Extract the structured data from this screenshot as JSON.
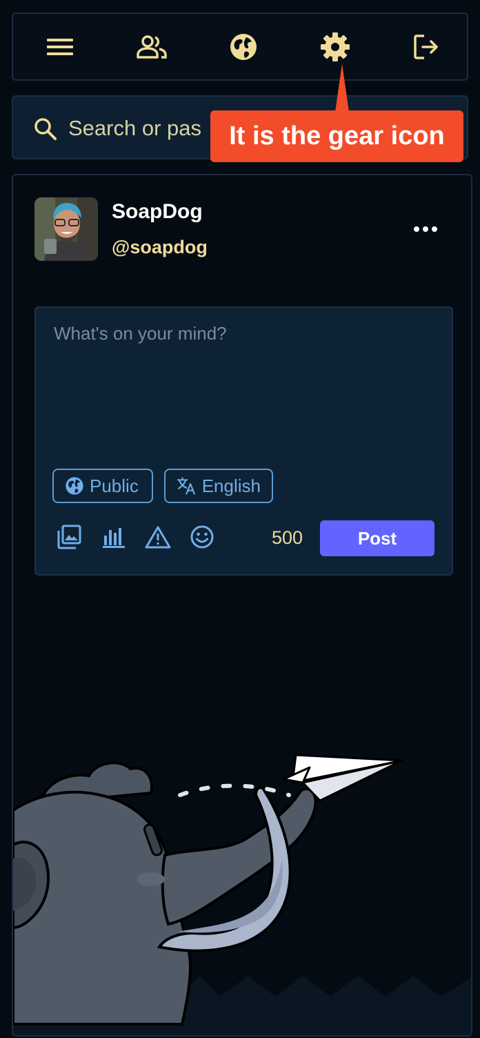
{
  "navbar": {
    "icons": [
      "hamburger-icon",
      "people-icon",
      "globe-icon",
      "gear-icon",
      "logout-icon"
    ],
    "icon_color": "#f0dc98"
  },
  "search": {
    "placeholder": "Search or paste URL",
    "value": "Search or pas"
  },
  "annotation": {
    "text": "It is the gear icon",
    "color": "#f24c2b"
  },
  "profile": {
    "display_name": "SoapDog",
    "handle": "@soapdog"
  },
  "compose": {
    "placeholder": "What's on your mind?",
    "visibility_label": "Public",
    "language_label": "English",
    "char_counter": "500",
    "post_label": "Post",
    "tools": [
      "media-icon",
      "poll-icon",
      "content-warning-icon",
      "emoji-icon"
    ],
    "accent": "#6364ff"
  }
}
